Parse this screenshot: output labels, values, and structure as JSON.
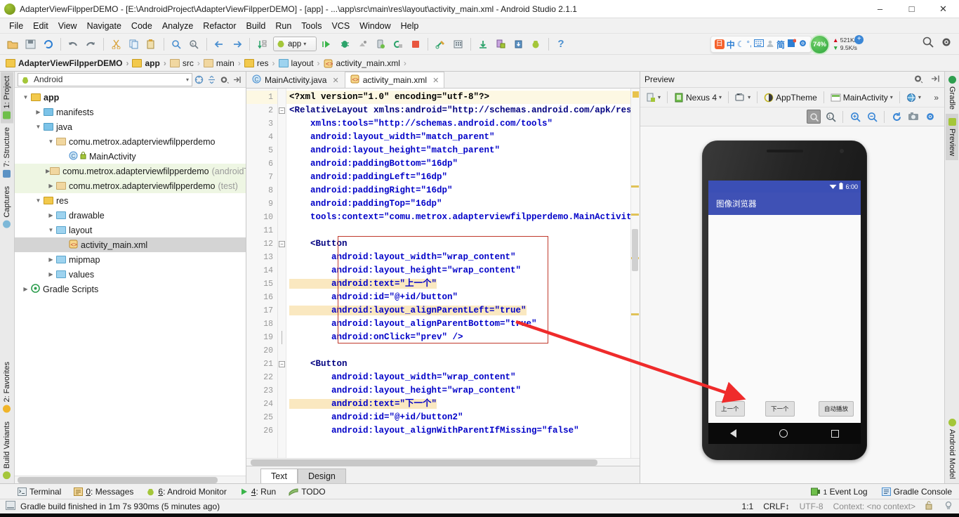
{
  "window": {
    "title": "AdapterViewFilpperDEMO - [E:\\AndroidProject\\AdapterViewFilpperDEMO] - [app] - ...\\app\\src\\main\\res\\layout\\activity_main.xml - Android Studio 2.1.1",
    "minimize_label": "–",
    "maximize_label": "□",
    "close_label": "✕"
  },
  "menubar": {
    "items": [
      "File",
      "Edit",
      "View",
      "Navigate",
      "Code",
      "Analyze",
      "Refactor",
      "Build",
      "Run",
      "Tools",
      "VCS",
      "Window",
      "Help"
    ]
  },
  "toolbar": {
    "run_config_label": "app",
    "icons": [
      "open-folder-icon",
      "save-all-icon",
      "sync-icon",
      "undo-icon",
      "redo-icon",
      "cut-icon",
      "copy-icon",
      "paste-icon",
      "find-icon",
      "replace-icon",
      "back-icon",
      "forward-icon",
      "sort-icon"
    ],
    "right_icons": [
      "run-icon",
      "debug-icon",
      "coverage-icon",
      "attach-debugger-icon",
      "rerun-icon",
      "stop-icon",
      "sdk-manager-icon",
      "avd-manager-icon",
      "sync-gradle-icon",
      "android-device-monitor-icon",
      "sdk-icon",
      "android-icon",
      "help-icon"
    ],
    "search_icon": "search-icon",
    "settings_icon": "gear-icon"
  },
  "tray": {
    "ime_items": [
      "sogou-logo-icon",
      "中",
      "moon-icon",
      "punctuation-icon",
      "keyboard-icon",
      "user-icon",
      "简",
      "clipboard-icon",
      "gear-icon"
    ],
    "cpu_percent": "74%",
    "upload_speed": "521K/s",
    "download_speed": "9.5K/s"
  },
  "breadcrumb": {
    "items": [
      {
        "label": "AdapterViewFilpperDEMO",
        "bold": true,
        "icon": "module-folder-icon"
      },
      {
        "label": "app",
        "bold": true,
        "icon": "module-folder-icon"
      },
      {
        "label": "src",
        "bold": false,
        "icon": "folder-icon"
      },
      {
        "label": "main",
        "bold": false,
        "icon": "folder-icon"
      },
      {
        "label": "res",
        "bold": false,
        "icon": "res-folder-icon"
      },
      {
        "label": "layout",
        "bold": false,
        "icon": "folder-icon"
      },
      {
        "label": "activity_main.xml",
        "bold": false,
        "icon": "xml-file-icon"
      }
    ],
    "separator": "›"
  },
  "left_tool_tabs": [
    {
      "label": "1: Project",
      "selected": true,
      "icon": "project-icon"
    },
    {
      "label": "7: Structure",
      "selected": false,
      "icon": "structure-icon"
    },
    {
      "label": "Captures",
      "selected": false,
      "icon": "captures-icon"
    },
    {
      "label": "2: Favorites",
      "selected": false,
      "icon": "star-icon"
    },
    {
      "label": "Build Variants",
      "selected": false,
      "icon": "android-icon"
    }
  ],
  "right_tool_tabs": [
    {
      "label": "Gradle",
      "selected": false,
      "icon": "gradle-icon"
    },
    {
      "label": "Preview",
      "selected": true,
      "icon": "preview-icon"
    },
    {
      "label": "Android Model",
      "selected": false,
      "icon": "android-icon"
    }
  ],
  "project_panel": {
    "view_selector": "Android",
    "view_icon": "android-icon",
    "header_icons": [
      "collapse-target-icon",
      "collapse-all-icon",
      "gear-icon",
      "hide-icon"
    ],
    "tree": [
      {
        "depth": 0,
        "twisty": "▼",
        "icon": "module-folder-icon",
        "label": "app",
        "bold": true,
        "dim": "",
        "state": ""
      },
      {
        "depth": 1,
        "twisty": "▶",
        "icon": "folder-icon",
        "label": "manifests",
        "bold": false,
        "dim": "",
        "state": ""
      },
      {
        "depth": 1,
        "twisty": "▼",
        "icon": "folder-icon",
        "label": "java",
        "bold": false,
        "dim": "",
        "state": ""
      },
      {
        "depth": 2,
        "twisty": "▼",
        "icon": "package-icon",
        "label": "comu.metrox.adapterviewfilpperdemo",
        "bold": false,
        "dim": "",
        "state": ""
      },
      {
        "depth": 3,
        "twisty": "",
        "icon": "java-class-icon",
        "label": "MainActivity",
        "bold": false,
        "dim": "",
        "state": ""
      },
      {
        "depth": 2,
        "twisty": "▶",
        "icon": "package-icon",
        "label": "comu.metrox.adapterviewfilpperdemo",
        "bold": false,
        "dim": "(androidTest)",
        "state": "hl"
      },
      {
        "depth": 2,
        "twisty": "▶",
        "icon": "package-icon",
        "label": "comu.metrox.adapterviewfilpperdemo",
        "bold": false,
        "dim": "(test)",
        "state": "hl"
      },
      {
        "depth": 1,
        "twisty": "▼",
        "icon": "res-folder-icon",
        "label": "res",
        "bold": false,
        "dim": "",
        "state": ""
      },
      {
        "depth": 2,
        "twisty": "▶",
        "icon": "folder-icon",
        "label": "drawable",
        "bold": false,
        "dim": "",
        "state": ""
      },
      {
        "depth": 2,
        "twisty": "▼",
        "icon": "folder-icon",
        "label": "layout",
        "bold": false,
        "dim": "",
        "state": ""
      },
      {
        "depth": 3,
        "twisty": "",
        "icon": "xml-file-icon",
        "label": "activity_main.xml",
        "bold": false,
        "dim": "",
        "state": "sel"
      },
      {
        "depth": 2,
        "twisty": "▶",
        "icon": "folder-icon",
        "label": "mipmap",
        "bold": false,
        "dim": "",
        "state": ""
      },
      {
        "depth": 2,
        "twisty": "▶",
        "icon": "folder-icon",
        "label": "values",
        "bold": false,
        "dim": "",
        "state": ""
      },
      {
        "depth": 0,
        "twisty": "▶",
        "icon": "gradle-icon",
        "label": "Gradle Scripts",
        "bold": false,
        "dim": "",
        "state": ""
      }
    ]
  },
  "editor": {
    "tabs": [
      {
        "label": "MainActivity.java",
        "icon": "java-class-icon",
        "active": false,
        "close": "✕"
      },
      {
        "label": "activity_main.xml",
        "icon": "xml-file-icon",
        "active": true,
        "close": "✕"
      }
    ],
    "bottom_tabs": [
      {
        "label": "Text",
        "active": true
      },
      {
        "label": "Design",
        "active": false
      }
    ],
    "line_numbers": [
      "1",
      "2",
      "3",
      "4",
      "5",
      "6",
      "7",
      "8",
      "9",
      "10",
      "11",
      "12",
      "13",
      "14",
      "15",
      "16",
      "17",
      "18",
      "19",
      "20",
      "21",
      "22",
      "23",
      "24",
      "25",
      "26"
    ],
    "lines": [
      "<?xml version=\"1.0\" encoding=\"utf-8\"?>",
      "<RelativeLayout xmlns:android=\"http://schemas.android.com/apk/res/andro",
      "    xmlns:tools=\"http://schemas.android.com/tools\"",
      "    android:layout_width=\"match_parent\"",
      "    android:layout_height=\"match_parent\"",
      "    android:paddingBottom=\"16dp\"",
      "    android:paddingLeft=\"16dp\"",
      "    android:paddingRight=\"16dp\"",
      "    android:paddingTop=\"16dp\"",
      "    tools:context=\"comu.metrox.adapterviewfilpperdemo.MainActivity\">",
      "",
      "    <Button",
      "        android:layout_width=\"wrap_content\"",
      "        android:layout_height=\"wrap_content\"",
      "        android:text=\"上一个\"",
      "        android:id=\"@+id/button\"",
      "        android:layout_alignParentLeft=\"true\"",
      "        android:layout_alignParentBottom=\"true\"",
      "        android:onClick=\"prev\" />",
      "",
      "    <Button",
      "        android:layout_width=\"wrap_content\"",
      "        android:layout_height=\"wrap_content\"",
      "        android:text=\"下一个\"",
      "        android:id=\"@+id/button2\"",
      "        android:layout_alignWithParentIfMissing=\"false\""
    ]
  },
  "preview": {
    "title": "Preview",
    "header_icons": [
      "gear-icon",
      "hide-icon"
    ],
    "toolbar": [
      {
        "label": "",
        "icon": "device-config-icon",
        "caret": true
      },
      {
        "label": "Nexus 4",
        "icon": "device-icon",
        "caret": true
      },
      {
        "label": "",
        "icon": "orientation-icon",
        "caret": true
      },
      {
        "label": "AppTheme",
        "icon": "theme-icon",
        "caret": false
      },
      {
        "label": "MainActivity",
        "icon": "activity-icon",
        "caret": true
      },
      {
        "label": "",
        "icon": "locale-globe-icon",
        "caret": true
      },
      {
        "label": "»",
        "icon": "overflow-icon",
        "caret": false
      }
    ],
    "zoom_buttons": [
      "zoom-fit-icon",
      "zoom-actual-icon",
      "zoom-in-icon",
      "zoom-out-icon",
      "refresh-icon",
      "screenshot-icon",
      "gear-icon"
    ],
    "device": {
      "status_time": "6:00",
      "status_icons": [
        "wifi-icon",
        "battery-icon"
      ],
      "app_title": "图像浏览器",
      "buttons": [
        {
          "label": "上一个"
        },
        {
          "label": "下一个"
        },
        {
          "label": "自动播放"
        }
      ],
      "nav_icons": [
        "back-triangle-icon",
        "home-circle-icon",
        "recents-square-icon"
      ]
    }
  },
  "tool_window_bar": {
    "items": [
      {
        "label": "Terminal",
        "num": "",
        "icon": "terminal-icon"
      },
      {
        "label": ": Messages",
        "num": "0",
        "icon": "messages-icon"
      },
      {
        "label": ": Android Monitor",
        "num": "6",
        "icon": "android-icon"
      },
      {
        "label": ": Run",
        "num": "4",
        "icon": "run-icon"
      },
      {
        "label": "TODO",
        "num": "",
        "icon": "todo-icon"
      }
    ],
    "right_items": [
      {
        "label": "Event Log",
        "num": "1",
        "icon": "event-log-icon"
      },
      {
        "label": "Gradle Console",
        "num": "",
        "icon": "gradle-console-icon"
      }
    ]
  },
  "status_bar": {
    "message": "Gradle build finished in 1m 7s 930ms (5 minutes ago)",
    "message_icon": "build-icon",
    "caret_position": "1:1",
    "line_separator": "CRLF↕",
    "encoding": "UTF-8",
    "context": "Context: <no context>",
    "lock_icon": "unlocked-icon",
    "inspection_icon": "inspection-icon"
  },
  "colors": {
    "accent": "#3f51b5",
    "selection": "#d4d4d4",
    "highlight_green": "#eef6e3",
    "code_tag": "#000080",
    "code_attr": "#0000c8",
    "code_value": "#008000",
    "red_box": "#c0392b",
    "arrow": "#ef2b2b"
  }
}
